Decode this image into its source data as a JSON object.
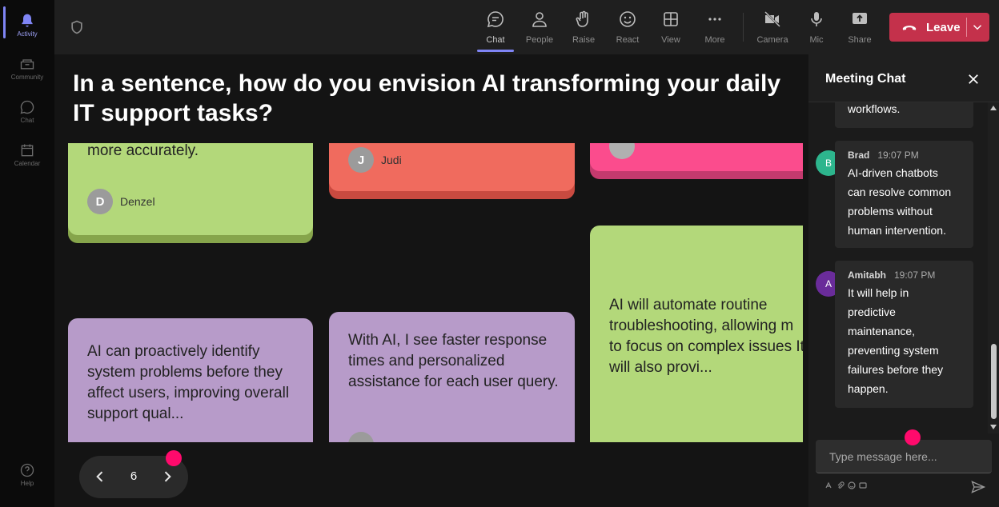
{
  "rail": {
    "items": [
      {
        "label": "Activity",
        "icon": "bell-icon",
        "active": true
      },
      {
        "label": "Community",
        "icon": "community-icon"
      },
      {
        "label": "Chat",
        "icon": "chat-icon"
      },
      {
        "label": "Calendar",
        "icon": "calendar-icon"
      }
    ],
    "help": {
      "label": "Help",
      "icon": "help-icon"
    }
  },
  "toolbar": {
    "chat": "Chat",
    "people": "People",
    "raise": "Raise",
    "react": "React",
    "view": "View",
    "more": "More",
    "camera": "Camera",
    "mic": "Mic",
    "share": "Share",
    "leave": "Leave"
  },
  "stage": {
    "question": "In a sentence, how do you envision AI transforming your daily IT support tasks?",
    "cards": [
      {
        "color": "#b3d87a",
        "text": "more accurately.",
        "author": "Denzel",
        "initial": "D"
      },
      {
        "color": "#f06b5e",
        "text": "",
        "author": "Judi",
        "initial": "J"
      },
      {
        "color": "#fb4c8d",
        "text": "",
        "author": "",
        "initial": ""
      },
      {
        "color": "#b79bc9",
        "text": "AI can proactively identify system problems before they affect users, improving overall support qual...",
        "author": "",
        "initial": ""
      },
      {
        "color": "#b79bc9",
        "text": "With AI, I see faster response times and personalized assistance for each user query.",
        "author": "",
        "initial": ""
      },
      {
        "color": "#b3d87a",
        "text": "AI will automate routine troubleshooting, allowing m to focus on complex issues It will also provi...",
        "author": "",
        "initial": ""
      }
    ],
    "page": "6"
  },
  "chat": {
    "title": "Meeting Chat",
    "partial_message": "workflows.",
    "messages": [
      {
        "initial": "B",
        "avatar_color": "#2db58d",
        "name": "Brad",
        "time": "19:07 PM",
        "lines": [
          "AI-driven chatbots",
          "can resolve common",
          "problems without",
          "human intervention."
        ]
      },
      {
        "initial": "A",
        "avatar_color": "#6a2c9a",
        "name": "Amitabh",
        "time": "19:07 PM",
        "lines": [
          "It will help in",
          "predictive",
          "maintenance,",
          "preventing system",
          "failures before they",
          "happen."
        ]
      }
    ],
    "compose_placeholder": "Type message here..."
  },
  "colors": {
    "accent": "#7f85f5",
    "leave": "#c4314b",
    "pointer": "#ff0a6c"
  }
}
